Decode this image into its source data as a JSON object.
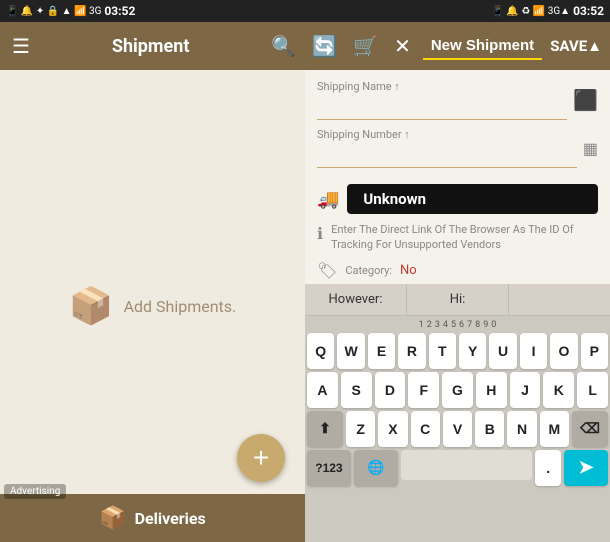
{
  "statusBar": {
    "leftIcons": "📱 🔔 ♻ 🔒 📶",
    "time": "03:52",
    "rightIcons": "📱 🔔 ♻ 📶 3G",
    "rightTime": "03:52"
  },
  "toolbar": {
    "menuIcon": "☰",
    "title": "Shipment",
    "searchIcon": "🔍",
    "refreshIcon": "🔄",
    "cartIcon": "🛒",
    "closeIcon": "✕",
    "newShipmentLabel": "New Shipment",
    "saveLabel": "SAVE▲"
  },
  "leftPanel": {
    "addShipmentLabel": "Add Shipments.",
    "fabIcon": "+",
    "advertisingLabel": "Advertising",
    "deliveriesIcon": "📦",
    "deliveriesLabel": "Deliveries"
  },
  "rightPanel": {
    "shippingNameLabel": "Shipping Name ↑",
    "shippingNamePlaceholder": "",
    "shippingNumberLabel": "Shipping Number ↑",
    "shippingNumberPlaceholder": "",
    "carrierIcon": "🚚",
    "carrierValue": "Unknown",
    "infoIcon": "ℹ",
    "infoText": "Enter The Direct Link Of The Browser As The ID Of Tracking For Unsupported Vendors",
    "tagIcon": "🏷",
    "categoryLabel": "Category:",
    "categoryValue": "No"
  },
  "keyboard": {
    "suggestLeft": "However:",
    "suggestMiddle": "Hi:",
    "suggestRight": "",
    "row1": [
      "Q",
      "W",
      "E",
      "R",
      "T",
      "Y",
      "U",
      "I",
      "O",
      "P"
    ],
    "row2": [
      "A",
      "S",
      "D",
      "F",
      "G",
      "H",
      "J",
      "K",
      "L"
    ],
    "row3": [
      "Z",
      "X",
      "C",
      "V",
      "B",
      "N",
      "M"
    ],
    "specialKeys": {
      "shift": "⬆",
      "delete": "⌫",
      "number": "?123",
      "comma": ",",
      "globe": "🌐",
      "space": "",
      "period": ".",
      "enter": "➤"
    }
  }
}
